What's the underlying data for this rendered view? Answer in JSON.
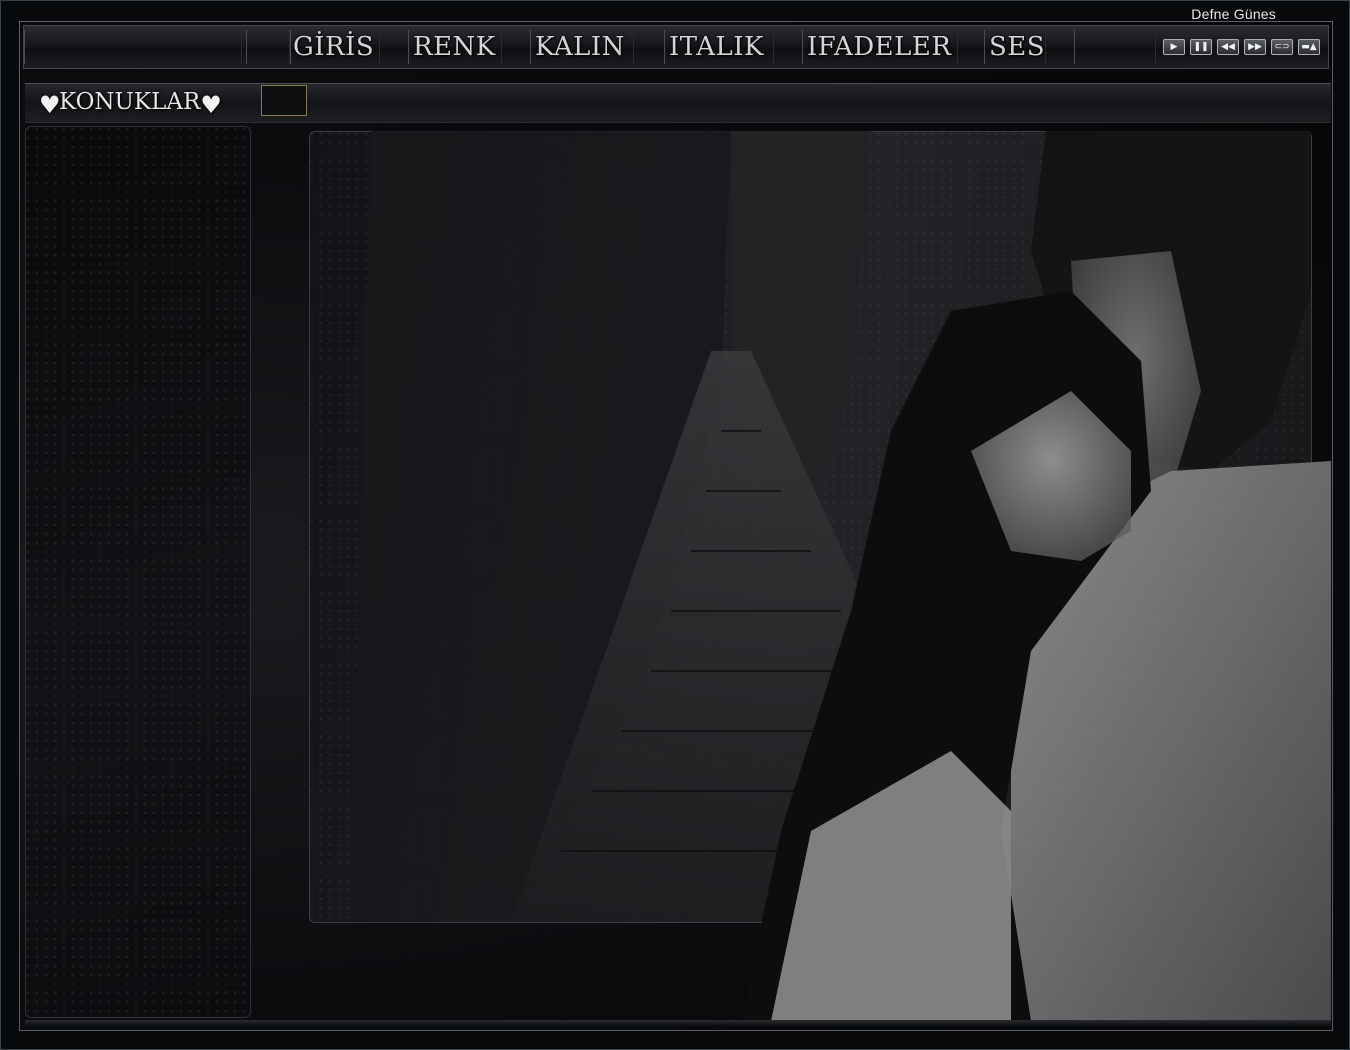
{
  "window": {
    "owner_name": "Defne Günes"
  },
  "menu": {
    "items": [
      {
        "id": "giris",
        "label": "GİRİS"
      },
      {
        "id": "renk",
        "label": "RENK"
      },
      {
        "id": "kalin",
        "label": "KALIN"
      },
      {
        "id": "italik",
        "label": "ITALIK"
      },
      {
        "id": "ifadeler",
        "label": "IFADELER"
      },
      {
        "id": "ses",
        "label": "SES"
      }
    ]
  },
  "player": {
    "buttons": [
      {
        "name": "play-icon",
        "glyph": "▶"
      },
      {
        "name": "pause-icon",
        "glyph": "❚❚"
      },
      {
        "name": "rewind-icon",
        "glyph": "◀◀"
      },
      {
        "name": "fast-forward-icon",
        "glyph": "▶▶"
      },
      {
        "name": "loop-icon",
        "glyph": "⊂⊃"
      },
      {
        "name": "eject-icon",
        "glyph": "▬▲"
      }
    ]
  },
  "sidebar": {
    "title": "KONUKLAR",
    "heart_icon": "heart-icon"
  },
  "colors": {
    "background": "#08090b",
    "text": "#d4d4d6",
    "accent_border": "#8a7a52"
  }
}
